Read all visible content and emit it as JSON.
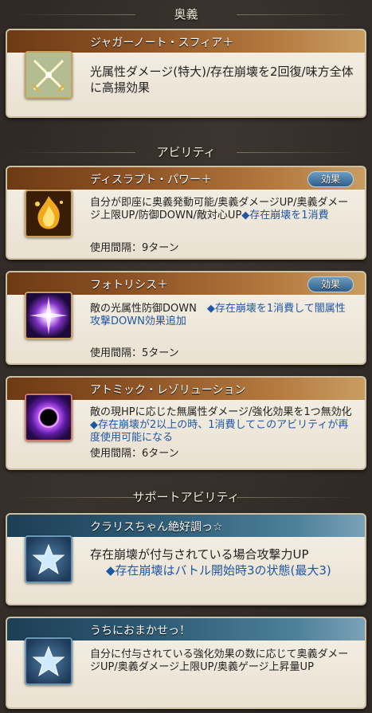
{
  "sections": {
    "ougi": "奥義",
    "abilities": "アビリティ",
    "support": "サポートアビリティ"
  },
  "ougi": {
    "name": "ジャガーノート・スフィア＋",
    "desc": "光属性ダメージ(特大)/存在崩壊を2回復/味方全体に高揚効果",
    "icon": "crossed-swords-icon"
  },
  "abilities": [
    {
      "name": "ディスラプト・パワー＋",
      "desc": "自分が即座に奥義発動可能/奥義ダメージUP/奥義ダメージ上限UP/防御DOWN/敵対心UP",
      "note": "◆存在崩壊を1消費",
      "cooldown": "使用間隔：9ターン",
      "effect_label": "効果",
      "icon": "golden-flame-icon"
    },
    {
      "name": "フォトリシス＋",
      "desc": "敵の光属性防御DOWN",
      "note": "◆存在崩壊を1消費して闇属性攻撃DOWN効果追加",
      "cooldown": "使用間隔：5ターン",
      "effect_label": "効果",
      "icon": "violet-burst-icon"
    },
    {
      "name": "アトミック・レゾリューション",
      "desc": "敵の現HPに応じた無属性ダメージ/強化効果を1つ無効化",
      "note": "◆存在崩壊が2以上の時、1消費してこのアビリティが再度使用可能になる",
      "cooldown": "使用間隔：6ターン",
      "icon": "dark-orb-icon"
    }
  ],
  "support": [
    {
      "name": "クラリスちゃん絶好調っ☆",
      "desc": "存在崩壊が付与されている場合攻撃力UP",
      "note": "◆存在崩壊はバトル開始時3の状態(最大3)",
      "icon": "star-icon"
    },
    {
      "name": "うちにおまかせっ！",
      "desc": "自分に付与されている強化効果の数に応じて奥義ダメージUP/奥義ダメージ上限UP/奥義ゲージ上昇量UP",
      "icon": "star-icon"
    }
  ]
}
